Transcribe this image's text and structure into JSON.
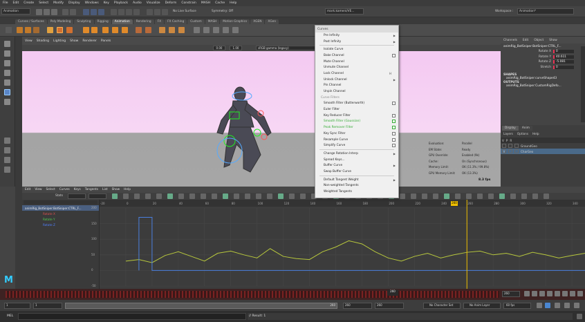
{
  "menubar": [
    "File",
    "Edit",
    "Create",
    "Select",
    "Modify",
    "Display",
    "Windows",
    "Key",
    "Playback",
    "Audio",
    "Visualize",
    "Deform",
    "Constrain",
    "MASH",
    "Cache",
    "Help"
  ],
  "status_line": {
    "menuset": "Animation",
    "live_surface": "No Live Surface",
    "symmetry": "Symmetry: Off",
    "user": "mark.kameni/VE...",
    "workspace": "Workspace :",
    "workspace_value": "Animation*"
  },
  "shelf_tabs": [
    "Curves / Surfaces",
    "Poly Modeling",
    "Sculpting",
    "Rigging",
    "Animation",
    "Rendering",
    "FX",
    "FX Caching",
    "Custom",
    "MASH",
    "Motion Graphics",
    "XGEN",
    "XGen"
  ],
  "shelf_active": "Animation",
  "viewport": {
    "menus": [
      "View",
      "Shading",
      "Lighting",
      "Show",
      "Renderer",
      "Panels"
    ],
    "field1": "0.00",
    "field2": "1.00",
    "color_space": "sRGB gamma (legacy)",
    "hud": [
      {
        "k": "Evaluation:",
        "v": "Parallel"
      },
      {
        "k": "EM State:",
        "v": "Ready"
      },
      {
        "k": "GPU Override:",
        "v": "Enabled (9k)"
      },
      {
        "k": "Cache:",
        "v": "On (Synchronous)"
      },
      {
        "k": "Memory Limit:",
        "v": "OK (11.3% / 99.8%)"
      },
      {
        "k": "GPU Memory Limit:",
        "v": "OK (13.3%)"
      }
    ],
    "fps": "8.3 fps"
  },
  "context_menu": {
    "title": "Curves",
    "items": [
      {
        "label": "Pre Infinity",
        "arrow": true
      },
      {
        "label": "Post Infinity",
        "arrow": true
      },
      {
        "sep": true
      },
      {
        "label": "Isolate Curve"
      },
      {
        "label": "Bake Channel",
        "check": true
      },
      {
        "label": "Mute Channel"
      },
      {
        "label": "Unmute Channel"
      },
      {
        "label": "Lock Channel",
        "shortcut": "H"
      },
      {
        "label": "Unlock Channel",
        "arrow": true
      },
      {
        "label": "Pin Channel"
      },
      {
        "label": "Unpin Channel"
      },
      {
        "label": "Curve Filters",
        "header": true
      },
      {
        "label": "Smooth Filter (Butterworth)",
        "check": true
      },
      {
        "label": "Euler Filter"
      },
      {
        "label": "Key Reducer Filter",
        "check": true
      },
      {
        "label": "Smooth Filter (Gaussian)",
        "check": true,
        "green": true
      },
      {
        "label": "Peak Remover Filter",
        "check": true,
        "green": true
      },
      {
        "label": "Key Sync Filter",
        "check": true
      },
      {
        "label": "Resample Curve",
        "check": true
      },
      {
        "label": "Simplify Curve",
        "check": true
      },
      {
        "sep": true
      },
      {
        "label": "Change Rotation Interp",
        "arrow": true
      },
      {
        "label": "Spread Keys..."
      },
      {
        "label": "Buffer Curve",
        "arrow": true
      },
      {
        "label": "Swap Buffer Curve"
      },
      {
        "sep": true
      },
      {
        "label": "Default Tangent Weight",
        "arrow": true
      },
      {
        "label": "Non-weighted Tangents"
      },
      {
        "label": "Weighted Tangents"
      }
    ]
  },
  "channel_box": {
    "menus": [
      "Channels",
      "Edit",
      "Object",
      "Show"
    ],
    "node": "animRig_BotSniper:BotSniper:CTRL_F...",
    "channels": [
      {
        "name": "Rotate X",
        "value": "0"
      },
      {
        "name": "Rotate Y",
        "value": "40.611"
      },
      {
        "name": "Rotate Z",
        "value": "-5.081"
      },
      {
        "name": "Stretch",
        "value": "0"
      }
    ],
    "shapes_label": "SHAPES",
    "shape_item": "animRig_BotSniper:curveShape43",
    "outputs_label": "OUTPUTS",
    "output_item": "animRig_BotSniper:CustomRigDefo..."
  },
  "layer_editor": {
    "tabs": [
      "Display",
      "Anim"
    ],
    "menus": [
      "Layers",
      "Options",
      "Help"
    ],
    "header": [
      "V",
      "P",
      "R"
    ],
    "layers": [
      {
        "v": "",
        "p": "",
        "r": "",
        "name": "GroundGeo"
      },
      {
        "v": "V",
        "p": "",
        "r": "",
        "name": "CharGeo",
        "selected": true
      }
    ]
  },
  "graph_editor": {
    "menus": [
      "Edit",
      "View",
      "Select",
      "Curves",
      "Keys",
      "Tangents",
      "List",
      "Show",
      "Help"
    ],
    "stats_label": "Stats",
    "outliner": {
      "root": "animRig_BotSniper:BotSniper:CTRL_F...",
      "channels": [
        {
          "name": "Rotate X",
          "color": "#e05050"
        },
        {
          "name": "Rotate Y",
          "color": "#50d050"
        },
        {
          "name": "Rotate Z",
          "color": "#5080ff"
        }
      ]
    },
    "y_ticks": [
      "200",
      "150",
      "100",
      "50",
      "0",
      "-50"
    ],
    "x_ticks": [
      "-20",
      "0",
      "20",
      "40",
      "60",
      "80",
      "100",
      "120",
      "140",
      "160",
      "180",
      "200",
      "220",
      "240",
      "260",
      "280",
      "300",
      "320",
      "340",
      "360"
    ],
    "current_frame": "260"
  },
  "chart_data": {
    "type": "line",
    "title": "",
    "xlabel": "",
    "ylabel": "",
    "xlim": [
      -20,
      350
    ],
    "ylim": [
      -50,
      200
    ],
    "series": [
      {
        "name": "Rotate Y",
        "color": "#b8c83c",
        "x": [
          0,
          10,
          20,
          30,
          40,
          50,
          60,
          70,
          80,
          90,
          100,
          110,
          120,
          130,
          140,
          150,
          160,
          170,
          180,
          190,
          200,
          210,
          220,
          230,
          240,
          250,
          260,
          270,
          280,
          290,
          300,
          310,
          320,
          330,
          340,
          350,
          360
        ],
        "y": [
          30,
          35,
          25,
          48,
          60,
          45,
          30,
          55,
          62,
          50,
          40,
          70,
          45,
          38,
          35,
          60,
          75,
          95,
          85,
          60,
          40,
          30,
          45,
          55,
          40,
          50,
          58,
          62,
          50,
          55,
          45,
          58,
          50,
          40,
          48,
          55,
          45
        ]
      },
      {
        "name": "Rotate Z",
        "color": "#4a80e0",
        "x": [
          10,
          10,
          20,
          20,
          30,
          40,
          50,
          60,
          70,
          80,
          90,
          100,
          120,
          140,
          160,
          180,
          200,
          220,
          240,
          260,
          280,
          300,
          320,
          340,
          360
        ],
        "y": [
          0,
          170,
          170,
          0,
          0,
          0,
          0,
          0,
          0,
          0,
          0,
          0,
          0,
          0,
          0,
          0,
          0,
          0,
          0,
          0,
          0,
          0,
          0,
          0,
          0
        ]
      }
    ]
  },
  "time_slider": {
    "current": "260"
  },
  "range": {
    "start": "1",
    "inner_start": "1",
    "inner_end": "260",
    "end_a": "260",
    "end_b": "260",
    "char_set": "No Character Set",
    "anim_layer": "No Anim Layer",
    "fps": "60 fps"
  },
  "command": {
    "lang": "MEL",
    "result": "// Result: 1"
  }
}
